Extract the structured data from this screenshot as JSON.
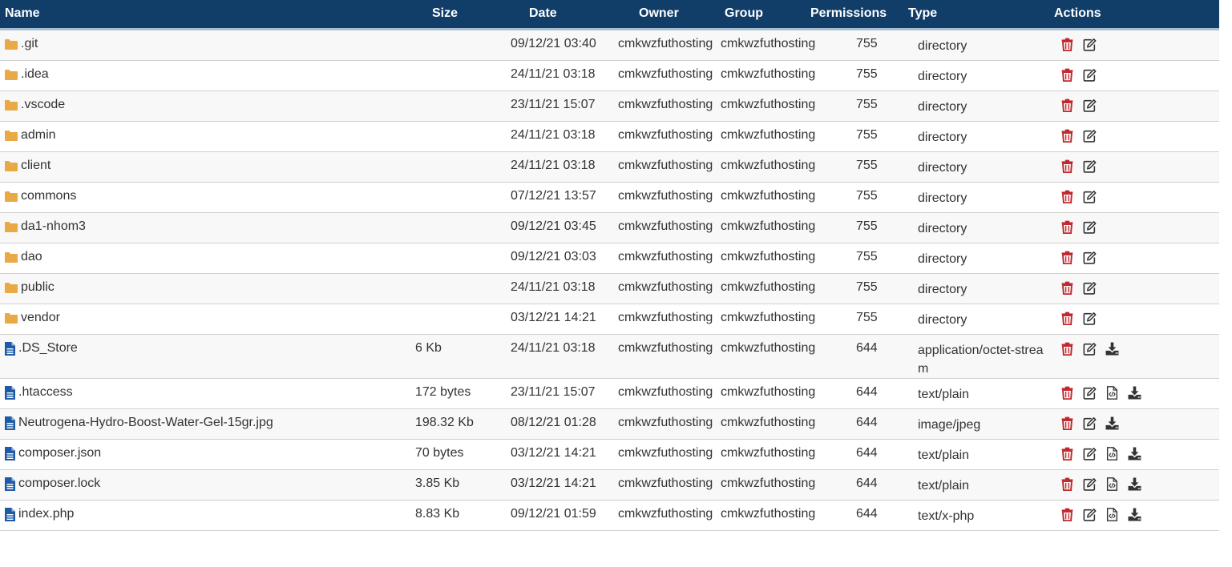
{
  "columns": {
    "name": "Name",
    "size": "Size",
    "date": "Date",
    "owner": "Owner",
    "group": "Group",
    "permissions": "Permissions",
    "type": "Type",
    "actions": "Actions"
  },
  "colors": {
    "header_bg": "#113d69",
    "folder": "#e9a945",
    "file": "#1f5aa6",
    "delete": "#c0272d",
    "action_dark": "#333333"
  },
  "rows": [
    {
      "name": ".git",
      "kind": "folder",
      "size": "",
      "date": "09/12/21 03:40",
      "owner": "cmkwzfuthosting",
      "group": "cmkwzfuthosting",
      "permissions": "755",
      "type": "directory",
      "actions": [
        "trash-icon",
        "edit-icon"
      ]
    },
    {
      "name": ".idea",
      "kind": "folder",
      "size": "",
      "date": "24/11/21 03:18",
      "owner": "cmkwzfuthosting",
      "group": "cmkwzfuthosting",
      "permissions": "755",
      "type": "directory",
      "actions": [
        "trash-icon",
        "edit-icon"
      ]
    },
    {
      "name": ".vscode",
      "kind": "folder",
      "size": "",
      "date": "23/11/21 15:07",
      "owner": "cmkwzfuthosting",
      "group": "cmkwzfuthosting",
      "permissions": "755",
      "type": "directory",
      "actions": [
        "trash-icon",
        "edit-icon"
      ]
    },
    {
      "name": "admin",
      "kind": "folder",
      "size": "",
      "date": "24/11/21 03:18",
      "owner": "cmkwzfuthosting",
      "group": "cmkwzfuthosting",
      "permissions": "755",
      "type": "directory",
      "actions": [
        "trash-icon",
        "edit-icon"
      ]
    },
    {
      "name": "client",
      "kind": "folder",
      "size": "",
      "date": "24/11/21 03:18",
      "owner": "cmkwzfuthosting",
      "group": "cmkwzfuthosting",
      "permissions": "755",
      "type": "directory",
      "actions": [
        "trash-icon",
        "edit-icon"
      ]
    },
    {
      "name": "commons",
      "kind": "folder",
      "size": "",
      "date": "07/12/21 13:57",
      "owner": "cmkwzfuthosting",
      "group": "cmkwzfuthosting",
      "permissions": "755",
      "type": "directory",
      "actions": [
        "trash-icon",
        "edit-icon"
      ]
    },
    {
      "name": "da1-nhom3",
      "kind": "folder",
      "size": "",
      "date": "09/12/21 03:45",
      "owner": "cmkwzfuthosting",
      "group": "cmkwzfuthosting",
      "permissions": "755",
      "type": "directory",
      "actions": [
        "trash-icon",
        "edit-icon"
      ]
    },
    {
      "name": "dao",
      "kind": "folder",
      "size": "",
      "date": "09/12/21 03:03",
      "owner": "cmkwzfuthosting",
      "group": "cmkwzfuthosting",
      "permissions": "755",
      "type": "directory",
      "actions": [
        "trash-icon",
        "edit-icon"
      ]
    },
    {
      "name": "public",
      "kind": "folder",
      "size": "",
      "date": "24/11/21 03:18",
      "owner": "cmkwzfuthosting",
      "group": "cmkwzfuthosting",
      "permissions": "755",
      "type": "directory",
      "actions": [
        "trash-icon",
        "edit-icon"
      ]
    },
    {
      "name": "vendor",
      "kind": "folder",
      "size": "",
      "date": "03/12/21 14:21",
      "owner": "cmkwzfuthosting",
      "group": "cmkwzfuthosting",
      "permissions": "755",
      "type": "directory",
      "actions": [
        "trash-icon",
        "edit-icon"
      ]
    },
    {
      "name": ".DS_Store",
      "kind": "file",
      "size": "6 Kb",
      "date": "24/11/21 03:18",
      "owner": "cmkwzfuthosting",
      "group": "cmkwzfuthosting",
      "permissions": "644",
      "type": "application/octet-stream",
      "actions": [
        "trash-icon",
        "edit-icon",
        "download-icon"
      ]
    },
    {
      "name": ".htaccess",
      "kind": "file",
      "size": "172 bytes",
      "date": "23/11/21 15:07",
      "owner": "cmkwzfuthosting",
      "group": "cmkwzfuthosting",
      "permissions": "644",
      "type": "text/plain",
      "actions": [
        "trash-icon",
        "edit-icon",
        "code-file-icon",
        "download-icon"
      ]
    },
    {
      "name": "Neutrogena-Hydro-Boost-Water-Gel-15gr.jpg",
      "kind": "file",
      "size": "198.32 Kb",
      "date": "08/12/21 01:28",
      "owner": "cmkwzfuthosting",
      "group": "cmkwzfuthosting",
      "permissions": "644",
      "type": "image/jpeg",
      "actions": [
        "trash-icon",
        "edit-icon",
        "download-icon"
      ]
    },
    {
      "name": "composer.json",
      "kind": "file",
      "size": "70 bytes",
      "date": "03/12/21 14:21",
      "owner": "cmkwzfuthosting",
      "group": "cmkwzfuthosting",
      "permissions": "644",
      "type": "text/plain",
      "actions": [
        "trash-icon",
        "edit-icon",
        "code-file-icon",
        "download-icon"
      ]
    },
    {
      "name": "composer.lock",
      "kind": "file",
      "size": "3.85 Kb",
      "date": "03/12/21 14:21",
      "owner": "cmkwzfuthosting",
      "group": "cmkwzfuthosting",
      "permissions": "644",
      "type": "text/plain",
      "actions": [
        "trash-icon",
        "edit-icon",
        "code-file-icon",
        "download-icon"
      ]
    },
    {
      "name": "index.php",
      "kind": "file",
      "size": "8.83 Kb",
      "date": "09/12/21 01:59",
      "owner": "cmkwzfuthosting",
      "group": "cmkwzfuthosting",
      "permissions": "644",
      "type": "text/x-php",
      "actions": [
        "trash-icon",
        "edit-icon",
        "code-file-icon",
        "download-icon"
      ]
    }
  ]
}
